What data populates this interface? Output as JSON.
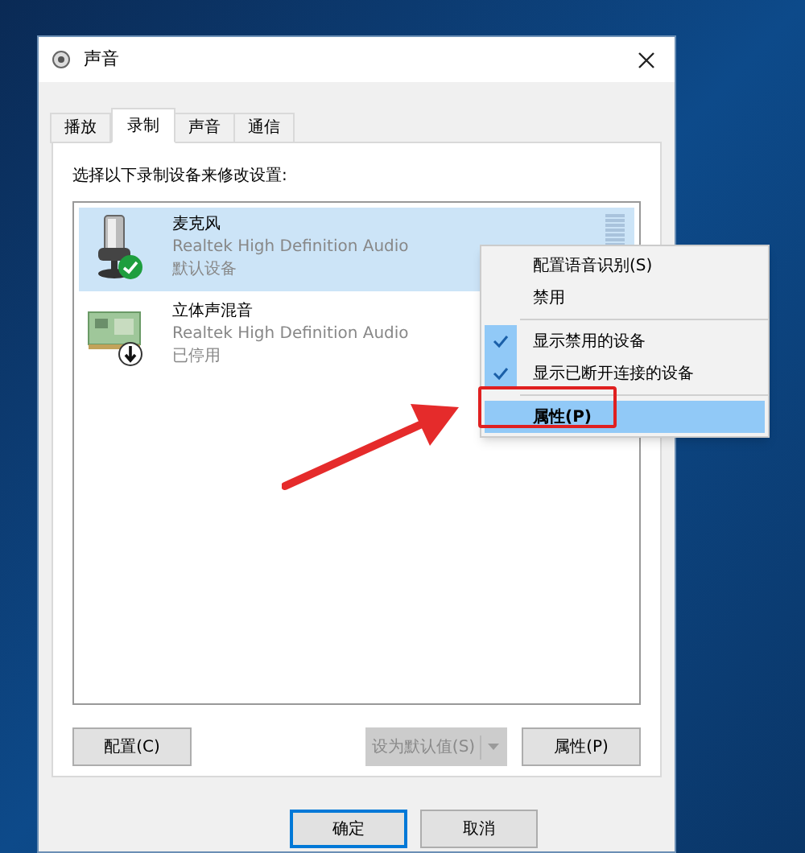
{
  "window": {
    "title": "声音"
  },
  "tabs": [
    {
      "label": "播放",
      "selected": false
    },
    {
      "label": "录制",
      "selected": true
    },
    {
      "label": "声音",
      "selected": false
    },
    {
      "label": "通信",
      "selected": false
    }
  ],
  "instruction": "选择以下录制设备来修改设置:",
  "devices": [
    {
      "name": "麦克风",
      "driver": "Realtek High Definition Audio",
      "status": "默认设备",
      "kind": "microphone",
      "default": true,
      "enabled": true,
      "selected": true
    },
    {
      "name": "立体声混音",
      "driver": "Realtek High Definition Audio",
      "status": "已停用",
      "kind": "board",
      "default": false,
      "enabled": false,
      "selected": false
    }
  ],
  "context_menu": [
    {
      "kind": "item",
      "label": "配置语音识别(S)",
      "checked": false,
      "selected": false
    },
    {
      "kind": "item",
      "label": "禁用",
      "checked": false,
      "selected": false
    },
    {
      "kind": "separator"
    },
    {
      "kind": "item",
      "label": "显示禁用的设备",
      "checked": true,
      "selected": false
    },
    {
      "kind": "item",
      "label": "显示已断开连接的设备",
      "checked": true,
      "selected": false
    },
    {
      "kind": "separator"
    },
    {
      "kind": "item",
      "label": "属性(P)",
      "checked": false,
      "selected": true
    }
  ],
  "device_buttons": [
    {
      "label": "配置(C)",
      "disabled": false
    },
    {
      "label": "设为默认值(S)",
      "disabled": true,
      "split": true
    },
    {
      "label": "属性(P)",
      "disabled": false
    }
  ],
  "dialog_buttons": [
    {
      "label": "确定",
      "default": true
    },
    {
      "label": "取消",
      "default": false
    }
  ]
}
